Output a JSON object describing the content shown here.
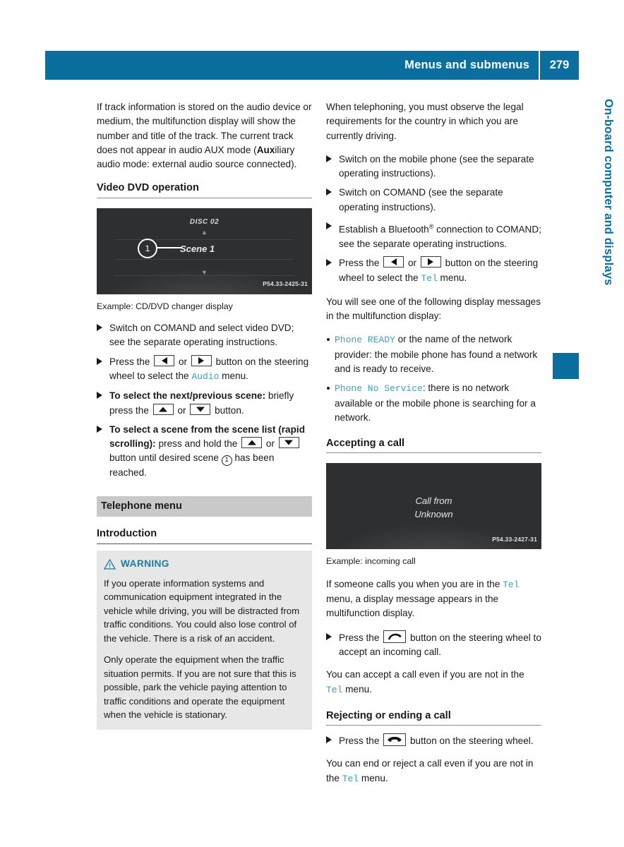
{
  "header": {
    "title": "Menus and submenus",
    "page_number": "279"
  },
  "side_tab": {
    "chapter_label": "On-board computer and displays"
  },
  "colors": {
    "brand_blue": "#0a6e9e",
    "code_teal": "#3f9fb5",
    "warning_teal": "#1a7e9c",
    "band_gray": "#c9c9c9",
    "warnbox_gray": "#e7e7e7"
  },
  "left_column": {
    "intro_paragraph_pre": "If track information is stored on the audio device or medium, the multifunction display will show the number and title of the track. The current track does not appear in audio AUX mode (",
    "intro_bold": "Aux",
    "intro_paragraph_post": "iliary audio mode: external audio source connected).",
    "video_dvd_heading": "Video DVD operation",
    "figure": {
      "disc_label": "DISC 02",
      "scene_label": "Scene 1",
      "callout_number": "1",
      "code": "P54.33-2425-31",
      "caption": "Example: CD/DVD changer display"
    },
    "steps": [
      {
        "parts": [
          {
            "type": "text",
            "value": "Switch on COMAND and select video DVD; see the separate operating instructions."
          }
        ]
      },
      {
        "parts": [
          {
            "type": "text",
            "value": "Press the "
          },
          {
            "type": "key",
            "value": "left"
          },
          {
            "type": "text",
            "value": " or "
          },
          {
            "type": "key",
            "value": "right"
          },
          {
            "type": "text",
            "value": " button on the steering wheel to select the "
          },
          {
            "type": "code",
            "value": "Audio"
          },
          {
            "type": "text",
            "value": " menu."
          }
        ]
      },
      {
        "parts": [
          {
            "type": "bold",
            "value": "To select the next/previous scene:"
          },
          {
            "type": "text",
            "value": " briefly press the "
          },
          {
            "type": "key",
            "value": "up"
          },
          {
            "type": "text",
            "value": " or "
          },
          {
            "type": "key",
            "value": "down"
          },
          {
            "type": "text",
            "value": " button."
          }
        ]
      },
      {
        "parts": [
          {
            "type": "bold",
            "value": "To select a scene from the scene list (rapid scrolling):"
          },
          {
            "type": "text",
            "value": " press and hold the "
          },
          {
            "type": "key",
            "value": "up"
          },
          {
            "type": "text",
            "value": " or "
          },
          {
            "type": "key",
            "value": "down"
          },
          {
            "type": "text",
            "value": " button until desired scene "
          },
          {
            "type": "circnum",
            "value": "1"
          },
          {
            "type": "text",
            "value": " has been reached."
          }
        ]
      }
    ],
    "telephone_band": "Telephone menu",
    "introduction_heading": "Introduction",
    "warning": {
      "label": "WARNING",
      "paragraphs": [
        "If you operate information systems and communication equipment integrated in the vehicle while driving, you will be distracted from traffic conditions. You could also lose control of the vehicle. There is a risk of an accident.",
        "Only operate the equipment when the traffic situation permits. If you are not sure that this is possible, park the vehicle paying attention to traffic conditions and operate the equipment when the vehicle is stationary."
      ]
    }
  },
  "right_column": {
    "intro_paragraph": "When telephoning, you must observe the legal requirements for the country in which you are currently driving.",
    "steps": [
      {
        "parts": [
          {
            "type": "text",
            "value": "Switch on the mobile phone (see the separate operating instructions)."
          }
        ]
      },
      {
        "parts": [
          {
            "type": "text",
            "value": "Switch on COMAND (see the separate operating instructions)."
          }
        ]
      },
      {
        "parts": [
          {
            "type": "text",
            "value": "Establish a Bluetooth"
          },
          {
            "type": "sup",
            "value": "®"
          },
          {
            "type": "text",
            "value": " connection to COMAND; see the separate operating instructions."
          }
        ]
      },
      {
        "parts": [
          {
            "type": "text",
            "value": "Press the "
          },
          {
            "type": "key",
            "value": "left"
          },
          {
            "type": "text",
            "value": " or "
          },
          {
            "type": "key",
            "value": "right"
          },
          {
            "type": "text",
            "value": " button on the steering wheel to select the "
          },
          {
            "type": "code",
            "value": "Tel"
          },
          {
            "type": "text",
            "value": " menu."
          }
        ]
      }
    ],
    "display_messages_intro": "You will see one of the following display messages in the multifunction display:",
    "messages": [
      {
        "code": "Phone READY",
        "text": " or the name of the network provider: the mobile phone has found a network and is ready to receive."
      },
      {
        "code": "Phone No Service",
        "text": ": there is no network available or the mobile phone is searching for a network."
      }
    ],
    "accepting_heading": "Accepting a call",
    "figure": {
      "line1": "Call from",
      "line2": "Unknown",
      "code": "P54.33-2427-31",
      "caption": "Example: incoming call"
    },
    "accepting_para_pre": "If someone calls you when you are in the ",
    "accepting_code": "Tel",
    "accepting_para_post": " menu, a display message appears in the multifunction display.",
    "accept_step": {
      "pre": "Press the ",
      "post": " button on the steering wheel to accept an incoming call."
    },
    "accept_note_pre": "You can accept a call even if you are not in the ",
    "accept_note_code": "Tel",
    "accept_note_post": " menu.",
    "rejecting_heading": "Rejecting or ending a call",
    "reject_step": {
      "pre": "Press the ",
      "post": " button on the steering wheel."
    },
    "reject_note_pre": "You can end or reject a call even if you are not in the ",
    "reject_note_code": "Tel",
    "reject_note_post": " menu."
  }
}
